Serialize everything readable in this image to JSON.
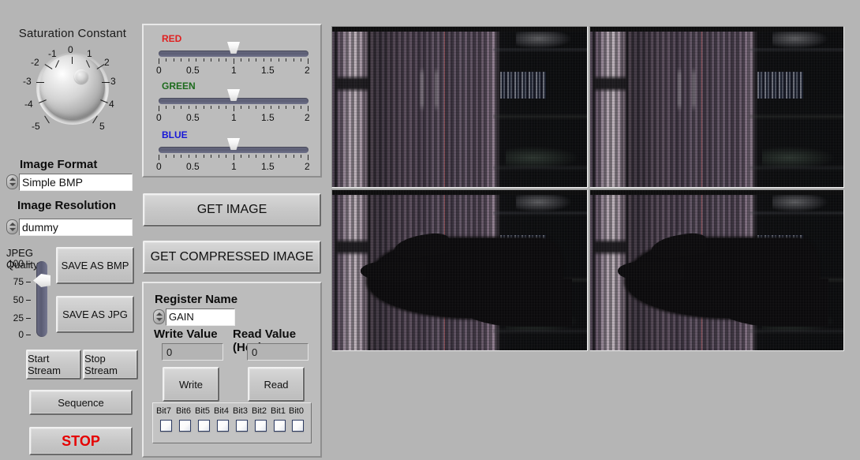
{
  "window": {
    "background_color": "#b5b5b5"
  },
  "knob": {
    "title": "Saturation Constant",
    "labels_left": [
      "-1",
      "-2",
      "-3",
      "-4",
      "-5"
    ],
    "label_top": "0",
    "labels_right": [
      "1",
      "2",
      "3",
      "4",
      "5"
    ],
    "value": 0
  },
  "format": {
    "image_format_label": "Image Format",
    "image_format_value": "Simple BMP",
    "image_resolution_label": "Image Resolution",
    "image_resolution_value": "dummy"
  },
  "jpeg": {
    "title": "JPEG Quality",
    "ticks": [
      "100",
      "75",
      "50",
      "25",
      "0"
    ],
    "value": 80
  },
  "save_buttons": {
    "save_bmp": "SAVE AS BMP",
    "save_jpg": "SAVE AS JPG"
  },
  "stream_buttons": {
    "start_stream": "Start Stream",
    "stop_stream": "Stop Stream",
    "sequence": "Sequence",
    "stop": "STOP",
    "stop_color": "#e60000"
  },
  "rgb_sliders": [
    {
      "name": "RED",
      "color": "#e02020",
      "value": 1,
      "min": 0,
      "max": 2,
      "ticks": [
        "0",
        "0.5",
        "1",
        "1.5",
        "2"
      ]
    },
    {
      "name": "GREEN",
      "color": "#1d6b1d",
      "value": 1,
      "min": 0,
      "max": 2,
      "ticks": [
        "0",
        "0.5",
        "1",
        "1.5",
        "2"
      ]
    },
    {
      "name": "BLUE",
      "color": "#1818d8",
      "value": 1,
      "min": 0,
      "max": 2,
      "ticks": [
        "0",
        "0.5",
        "1",
        "1.5",
        "2"
      ]
    }
  ],
  "capture_buttons": {
    "get_image": "GET IMAGE",
    "get_compressed_image": "GET COMPRESSED IMAGE"
  },
  "register": {
    "name_label": "Register Name",
    "name_value": "GAIN",
    "write_label": "Write Value",
    "write_value": "0",
    "read_label": "Read Value (Hex)",
    "read_value": "0",
    "write_button": "Write",
    "read_button": "Read",
    "bits": [
      {
        "label": "Bit7",
        "checked": false
      },
      {
        "label": "Bit6",
        "checked": false
      },
      {
        "label": "Bit5",
        "checked": false
      },
      {
        "label": "Bit4",
        "checked": false
      },
      {
        "label": "Bit3",
        "checked": false
      },
      {
        "label": "Bit2",
        "checked": false
      },
      {
        "label": "Bit1",
        "checked": false
      },
      {
        "label": "Bit0",
        "checked": false
      }
    ]
  },
  "image_panels": [
    {
      "id": "panel-top-left",
      "content": "dark-room-window-blinds-shelf"
    },
    {
      "id": "panel-top-right",
      "content": "dark-room-window-blinds-shelf"
    },
    {
      "id": "panel-bottom-left",
      "content": "dark-room-with-hand-silhouette"
    },
    {
      "id": "panel-bottom-right",
      "content": "dark-room-with-hand-silhouette"
    }
  ]
}
